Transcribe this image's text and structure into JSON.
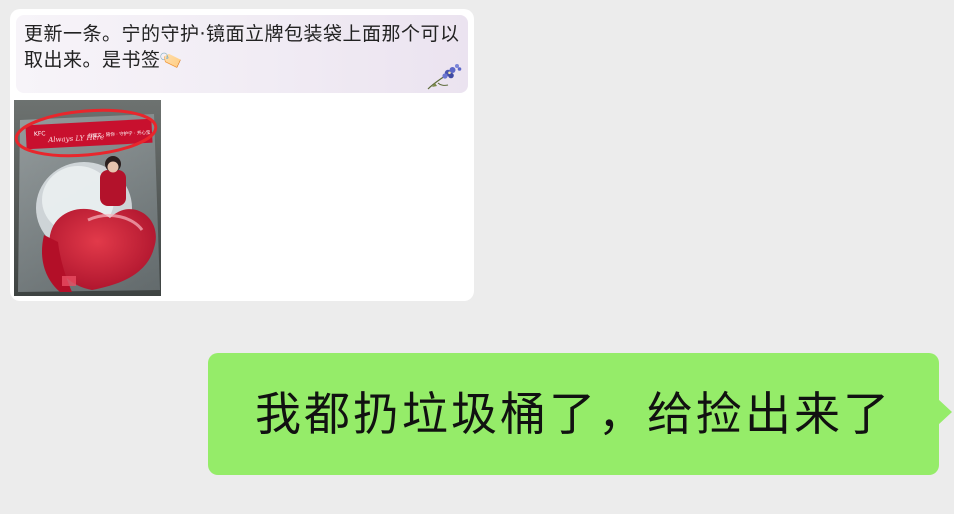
{
  "chat": {
    "incoming": {
      "quote_text": "更新一条。宁的守护·镜面立牌包装袋上面那个可以取出来。是书签",
      "quote_emoji": "🏷️",
      "photo_texts": {
        "kfc": "KFC",
        "brand_script": "Always LY Here",
        "banner_caption": "刘耀文 · 陪你 · 守护宁 · 开心宝"
      },
      "flower_icon": "flower-icon"
    },
    "outgoing": {
      "text": "我都扔垃圾桶了，给捡出来了"
    }
  },
  "colors": {
    "background": "#ececec",
    "incoming_bubble": "#ffffff",
    "outgoing_bubble": "#95ec69",
    "highlight_circle": "#e8262c",
    "banner_red": "#c8102e"
  }
}
